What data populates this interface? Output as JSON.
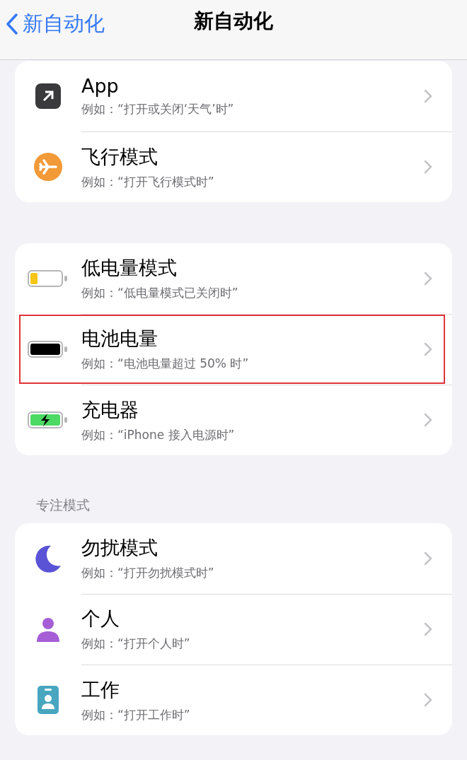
{
  "nav": {
    "back": "新自动化",
    "title": "新自动化"
  },
  "sections": [
    {
      "rows": [
        {
          "kind": "shortcut",
          "title": "App",
          "subtitle": "例如：“打开或关闭‘天气’时”",
          "highlighted": false
        },
        {
          "kind": "airplane",
          "title": "飞行模式",
          "subtitle": "例如：“打开飞行模式时”",
          "highlighted": false
        }
      ]
    },
    {
      "rows": [
        {
          "kind": "battery-low",
          "title": "低电量模式",
          "subtitle": "例如：“低电量模式已关闭时”",
          "highlighted": false
        },
        {
          "kind": "battery-full",
          "title": "电池电量",
          "subtitle": "例如：“电池电量超过 50% 时”",
          "highlighted": true
        },
        {
          "kind": "battery-charging",
          "title": "充电器",
          "subtitle": "例如：“iPhone 接入电源时”",
          "highlighted": false
        }
      ]
    },
    {
      "header": "专注模式",
      "rows": [
        {
          "kind": "moon",
          "title": "勿扰模式",
          "subtitle": "例如：“打开勿扰模式时”",
          "highlighted": false
        },
        {
          "kind": "person",
          "title": "个人",
          "subtitle": "例如：“打开个人时”",
          "highlighted": false
        },
        {
          "kind": "badge",
          "title": "工作",
          "subtitle": "例如：“打开工作时”",
          "highlighted": false
        }
      ]
    }
  ]
}
